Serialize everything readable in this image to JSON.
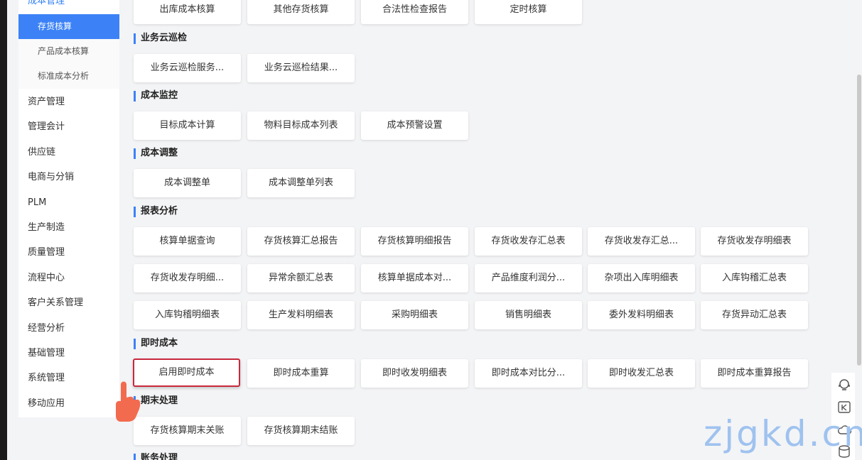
{
  "sidebar": {
    "group_label": "成本管理",
    "sub_items": [
      {
        "label": "存货核算",
        "active": true
      },
      {
        "label": "产品成本核算",
        "active": false
      },
      {
        "label": "标准成本分析",
        "active": false
      }
    ],
    "items": [
      "资产管理",
      "管理会计",
      "供应链",
      "电商与分销",
      "PLM",
      "生产制造",
      "质量管理",
      "流程中心",
      "客户关系管理",
      "经营分析",
      "基础管理",
      "系统管理",
      "移动应用"
    ]
  },
  "sections": {
    "top_row": [
      "出库成本核算",
      "其他存货核算",
      "合法性检查报告",
      "定时核算"
    ],
    "business_inspection": {
      "title": "业务云巡检",
      "buttons": [
        "业务云巡检服务...",
        "业务云巡检结果..."
      ]
    },
    "cost_monitoring": {
      "title": "成本监控",
      "buttons": [
        "目标成本计算",
        "物料目标成本列表",
        "成本预警设置"
      ]
    },
    "cost_adjustment": {
      "title": "成本调整",
      "buttons": [
        "成本调整单",
        "成本调整单列表"
      ]
    },
    "report_analysis": {
      "title": "报表分析",
      "row1": [
        "核算单据查询",
        "存货核算汇总报告",
        "存货核算明细报告",
        "存货收发存汇总表",
        "存货收发存汇总...",
        "存货收发存明细表"
      ],
      "row2": [
        "存货收发存明细...",
        "异常余额汇总表",
        "核算单据成本对...",
        "产品维度利润分...",
        "杂项出入库明细表",
        "入库钩稽汇总表"
      ],
      "row3": [
        "入库钩稽明细表",
        "生产发料明细表",
        "采购明细表",
        "销售明细表",
        "委外发料明细表",
        "存货异动汇总表"
      ]
    },
    "instant_cost": {
      "title": "即时成本",
      "buttons": [
        "启用即时成本",
        "即时成本重算",
        "即时收发明细表",
        "即时成本对比分...",
        "即时收发汇总表",
        "即时成本重算报告"
      ]
    },
    "period_end": {
      "title": "期末处理",
      "buttons": [
        "存货核算期末关账",
        "存货核算期末结账"
      ]
    },
    "account_processing": {
      "title": "账务处理"
    }
  },
  "watermark": "zjgkd.cn",
  "colors": {
    "accent": "#3c82f6",
    "highlight_border": "#c8283c",
    "pointer": "#f26b4f"
  }
}
